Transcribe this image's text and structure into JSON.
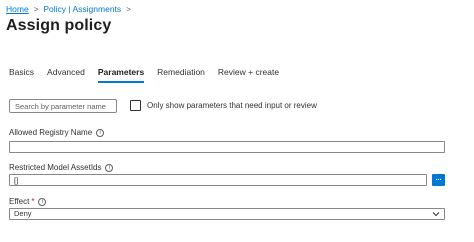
{
  "breadcrumb": {
    "home": "Home",
    "current": "Policy | Assignments",
    "separator": ">"
  },
  "page": {
    "title": "Assign policy",
    "more": "···"
  },
  "tabs": [
    {
      "label": "Basics",
      "active": false
    },
    {
      "label": "Advanced",
      "active": false
    },
    {
      "label": "Parameters",
      "active": true
    },
    {
      "label": "Remediation",
      "active": false
    },
    {
      "label": "Review + create",
      "active": false
    }
  ],
  "filters": {
    "search_placeholder": "Search by parameter name",
    "checkbox_label": "Only show parameters that need input or review",
    "checkbox_checked": false
  },
  "fields": {
    "allowed_registry": {
      "label": "Allowed Registry Name",
      "value": ""
    },
    "restricted_assets": {
      "label": "Restricted Model AssetIds",
      "value": "[]",
      "browse_label": "..."
    },
    "effect": {
      "label": "Effect",
      "required_mark": "*",
      "value": "Deny"
    }
  },
  "icons": {
    "info": "info-icon",
    "chevron": "chevron-down-icon",
    "chevron_right": "chevron-right-icon"
  },
  "colors": {
    "accent": "#0078d4",
    "text": "#323130",
    "border": "#8a8886",
    "required": "#a4262c"
  }
}
